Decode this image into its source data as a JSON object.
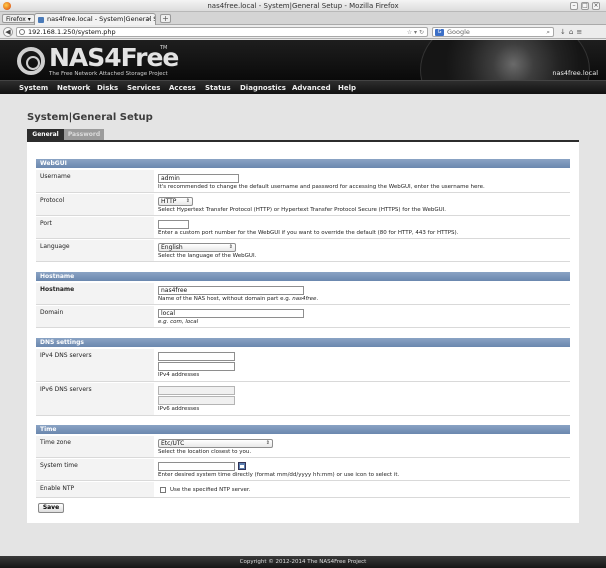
{
  "browser": {
    "window_title": "nas4free.local - System|General Setup - Mozilla Firefox",
    "menu_button": "Firefox",
    "tab_title": "nas4free.local - System|General Se...",
    "url": "192.168.1.250/system.php",
    "search_placeholder": "Google"
  },
  "header": {
    "logo_text": "NAS4Free",
    "trademark": "TM",
    "slogan": "The Free Network Attached Storage Project",
    "hostname": "nas4free.local"
  },
  "menu": [
    "System",
    "Network",
    "Disks",
    "Services",
    "Access",
    "Status",
    "Diagnostics",
    "Advanced",
    "Help"
  ],
  "page": {
    "title": "System|General Setup",
    "tabs": [
      "General",
      "Password"
    ]
  },
  "webgui": {
    "heading": "WebGUI",
    "username_label": "Username",
    "username_value": "admin",
    "username_hint": "It's recommended to change the default username and password for accessing the WebGUI, enter the username here.",
    "protocol_label": "Protocol",
    "protocol_value": "HTTP",
    "protocol_hint": "Select Hypertext Transfer Protocol (HTTP) or Hypertext Transfer Protocol Secure (HTTPS) for the WebGUI.",
    "port_label": "Port",
    "port_value": "",
    "port_hint": "Enter a custom port number for the WebGUI if you want to override the default (80 for HTTP, 443 for HTTPS).",
    "language_label": "Language",
    "language_value": "English",
    "language_hint": "Select the language of the WebGUI."
  },
  "hostname": {
    "heading": "Hostname",
    "hostname_label": "Hostname",
    "hostname_value": "nas4free",
    "hostname_hint": "Name of the NAS host, without domain part e.g.",
    "hostname_hint_example": "nas4free",
    "domain_label": "Domain",
    "domain_value": "local",
    "domain_hint_prefix": "e.g.",
    "domain_hint_example": "com, local"
  },
  "dns": {
    "heading": "DNS settings",
    "ipv4_label": "IPv4 DNS servers",
    "ipv4_hint": "IPv4 addresses",
    "ipv6_label": "IPv6 DNS servers",
    "ipv6_hint": "IPv6 addresses"
  },
  "time": {
    "heading": "Time",
    "timezone_label": "Time zone",
    "timezone_value": "Etc/UTC",
    "timezone_hint": "Select the location closest to you.",
    "systemtime_label": "System time",
    "systemtime_value": "",
    "systemtime_hint": "Enter desired system time directly (format mm/dd/yyyy hh:mm) or use icon to select it.",
    "ntp_label": "Enable NTP",
    "ntp_checkbox_label": "Use the specified NTP server.",
    "ntp_enabled": false
  },
  "actions": {
    "save": "Save"
  },
  "footer": {
    "copyright": "Copyright © 2012-2014 The NAS4Free Project"
  },
  "colors": {
    "section_header": "#7893b8",
    "menubar": "#1e1e1e",
    "page_bg": "#e4e4e4"
  }
}
